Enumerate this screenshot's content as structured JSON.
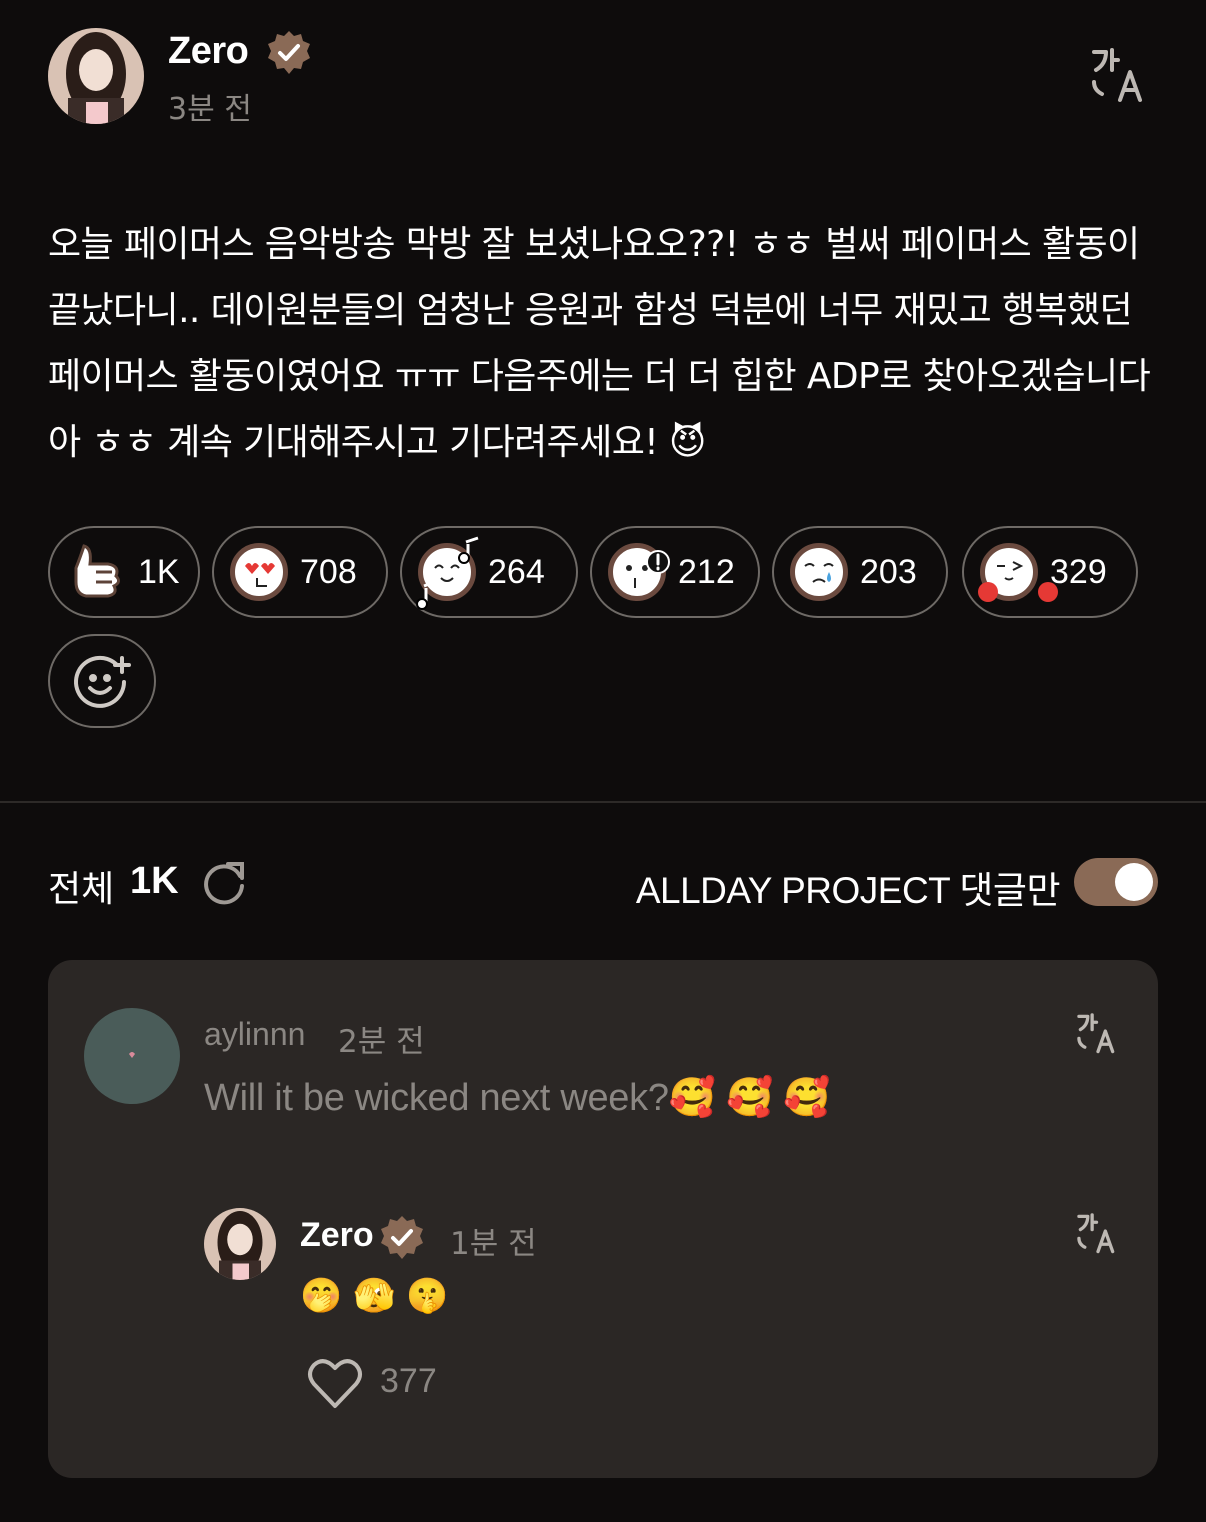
{
  "post": {
    "author": "Zero",
    "verified": true,
    "time": "3분 전",
    "body": "오늘 페이머스 음악방송 막방 잘 보셨나요오??! ㅎㅎ 벌써 페이머스 활동이 끝났다니.. 데이원분들의 엄청난 응원과 함성 덕분에 너무 재밌고 행복했던 페이머스 활동이였어요 ㅠㅠ 다음주에는 더 더 힙한 ADP로 찾아오겠습니다아 ㅎㅎ 계속 기대해주시고 기다려주세요! 😈"
  },
  "reactions": [
    {
      "icon": "thumbs-up-icon",
      "count": "1K"
    },
    {
      "icon": "heart-eyes-face-icon",
      "count": "708"
    },
    {
      "icon": "singing-face-icon",
      "count": "264"
    },
    {
      "icon": "surprised-face-icon",
      "count": "212"
    },
    {
      "icon": "crying-face-icon",
      "count": "203"
    },
    {
      "icon": "winking-blush-face-icon",
      "count": "329"
    }
  ],
  "comments_header": {
    "label": "전체",
    "count": "1K",
    "filter_label": "ALLDAY PROJECT 댓글만",
    "filter_on": true
  },
  "comment": {
    "user": "aylinnn",
    "time": "2분 전",
    "text": "Will it be wicked next week?🥰 🥰 🥰"
  },
  "reply": {
    "author": "Zero",
    "time": "1분 전",
    "text": "🤭 🫣 🤫",
    "likes": "377"
  },
  "colors": {
    "background": "#0e0c0c",
    "card": "#2b2725",
    "accent_brown": "#8a6a56",
    "muted_text": "#8b8783"
  }
}
